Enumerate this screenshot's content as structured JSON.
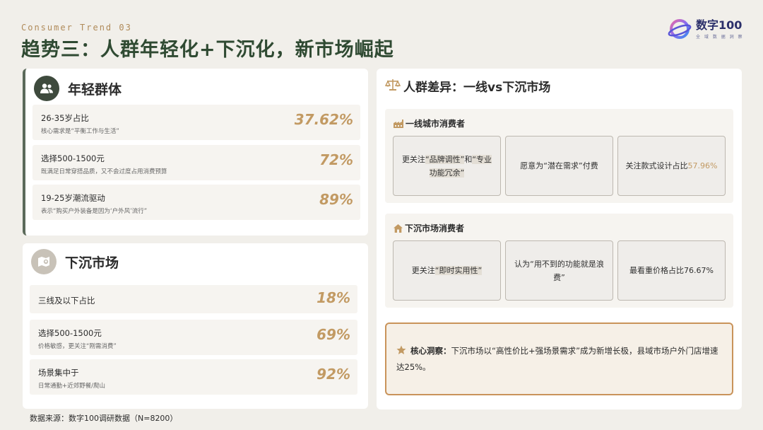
{
  "header": {
    "subtitle_en": "Consumer Trend 03",
    "title": "趋势三：人群年轻化+下沉化，新市场崛起"
  },
  "logo": {
    "name": "数字100",
    "sub": "全 域 数 据 洞 察"
  },
  "young": {
    "title": "年轻群体",
    "icon": "people-icon",
    "stats": [
      {
        "label": "26-35岁占比",
        "desc": "核心需求是“平衡工作与生活”",
        "value": "37.62%"
      },
      {
        "label": "选择500-1500元",
        "desc": "既满足日常穿搭品质，又不会过度占用消费预算",
        "value": "72%"
      },
      {
        "label": "19-25岁潮流驱动",
        "desc": "表示“购买户外装备是因为‘户外风’流行”",
        "value": "89%"
      }
    ]
  },
  "lower": {
    "title": "下沉市场",
    "icon": "map-pin-icon",
    "stats": [
      {
        "label": "三线及以下占比",
        "desc": "",
        "value": "18%"
      },
      {
        "label": "选择500-1500元",
        "desc": "价格敏感，更关注“刚需消费”",
        "value": "69%"
      },
      {
        "label": "场景集中于",
        "desc": "日常通勤+近郊野餐/爬山",
        "value": "92%"
      }
    ]
  },
  "diff": {
    "title": "人群差异：一线vs下沉市场",
    "icon": "scale-icon",
    "group1": {
      "title": "一线城市消费者",
      "icon": "factory-icon",
      "card1_pre": "更关注",
      "card1_hl1": "“品牌调性”",
      "card1_mid": "和",
      "card1_hl2": "“专业功能冗余”",
      "card2": "愿意为“潜在需求”付费",
      "card3_pre": "关注款式设计占比",
      "card3_value": "57.96%"
    },
    "group2": {
      "title": "下沉市场消费者",
      "icon": "home-icon",
      "card1_pre": "更关注",
      "card1_hl": "“即时实用性”",
      "card2": "认为“用不到的功能就是浪费”",
      "card3": "最看重价格占比76.67%"
    }
  },
  "insight": {
    "icon": "star-icon",
    "label": "核心洞察：",
    "text": "下沉市场以“高性价比+强场景需求”成为新增长极，县域市场户外门店增速达25%。"
  },
  "footer": {
    "source": "数据来源：数字100调研数据（N=8200）"
  },
  "colors": {
    "accent": "#c29a63",
    "title_green": "#2f4a32",
    "insight_border": "#c9935a"
  }
}
